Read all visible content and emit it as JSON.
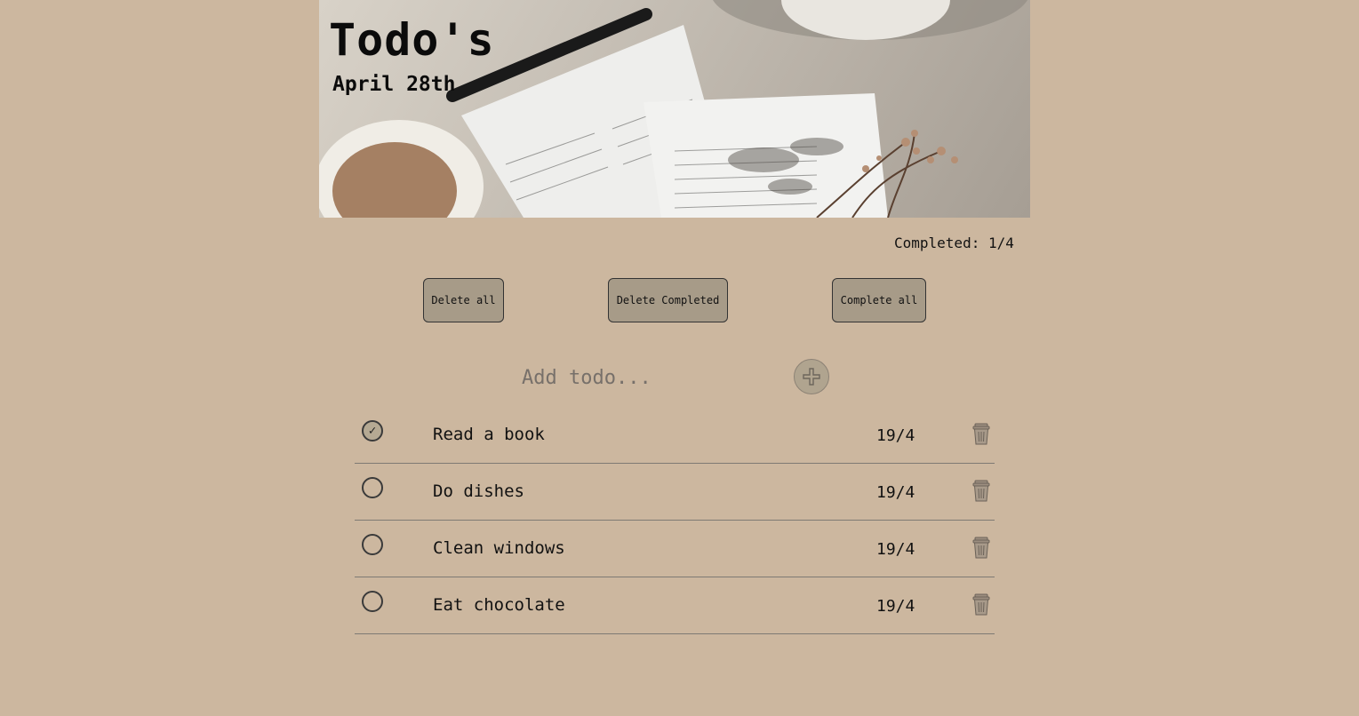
{
  "header": {
    "title": "Todo's",
    "date": "April 28th"
  },
  "stats": {
    "label": "Completed:",
    "completed": "1",
    "total": "4"
  },
  "actions": {
    "delete_all": "Delete all",
    "delete_completed": "Delete Completed",
    "complete_all": "Complete all"
  },
  "add": {
    "placeholder": "Add todo...",
    "value": ""
  },
  "todos": [
    {
      "text": "Read a book",
      "date": "19/4",
      "completed": true
    },
    {
      "text": "Do dishes",
      "date": "19/4",
      "completed": false
    },
    {
      "text": "Clean windows",
      "date": "19/4",
      "completed": false
    },
    {
      "text": "Eat chocolate",
      "date": "19/4",
      "completed": false
    }
  ],
  "icons": {
    "add": "plus-icon",
    "delete": "trash-icon",
    "check": "check-icon"
  },
  "colors": {
    "background": "#ccb79f",
    "button": "#a79b88",
    "add_button": "#b0a48f"
  }
}
